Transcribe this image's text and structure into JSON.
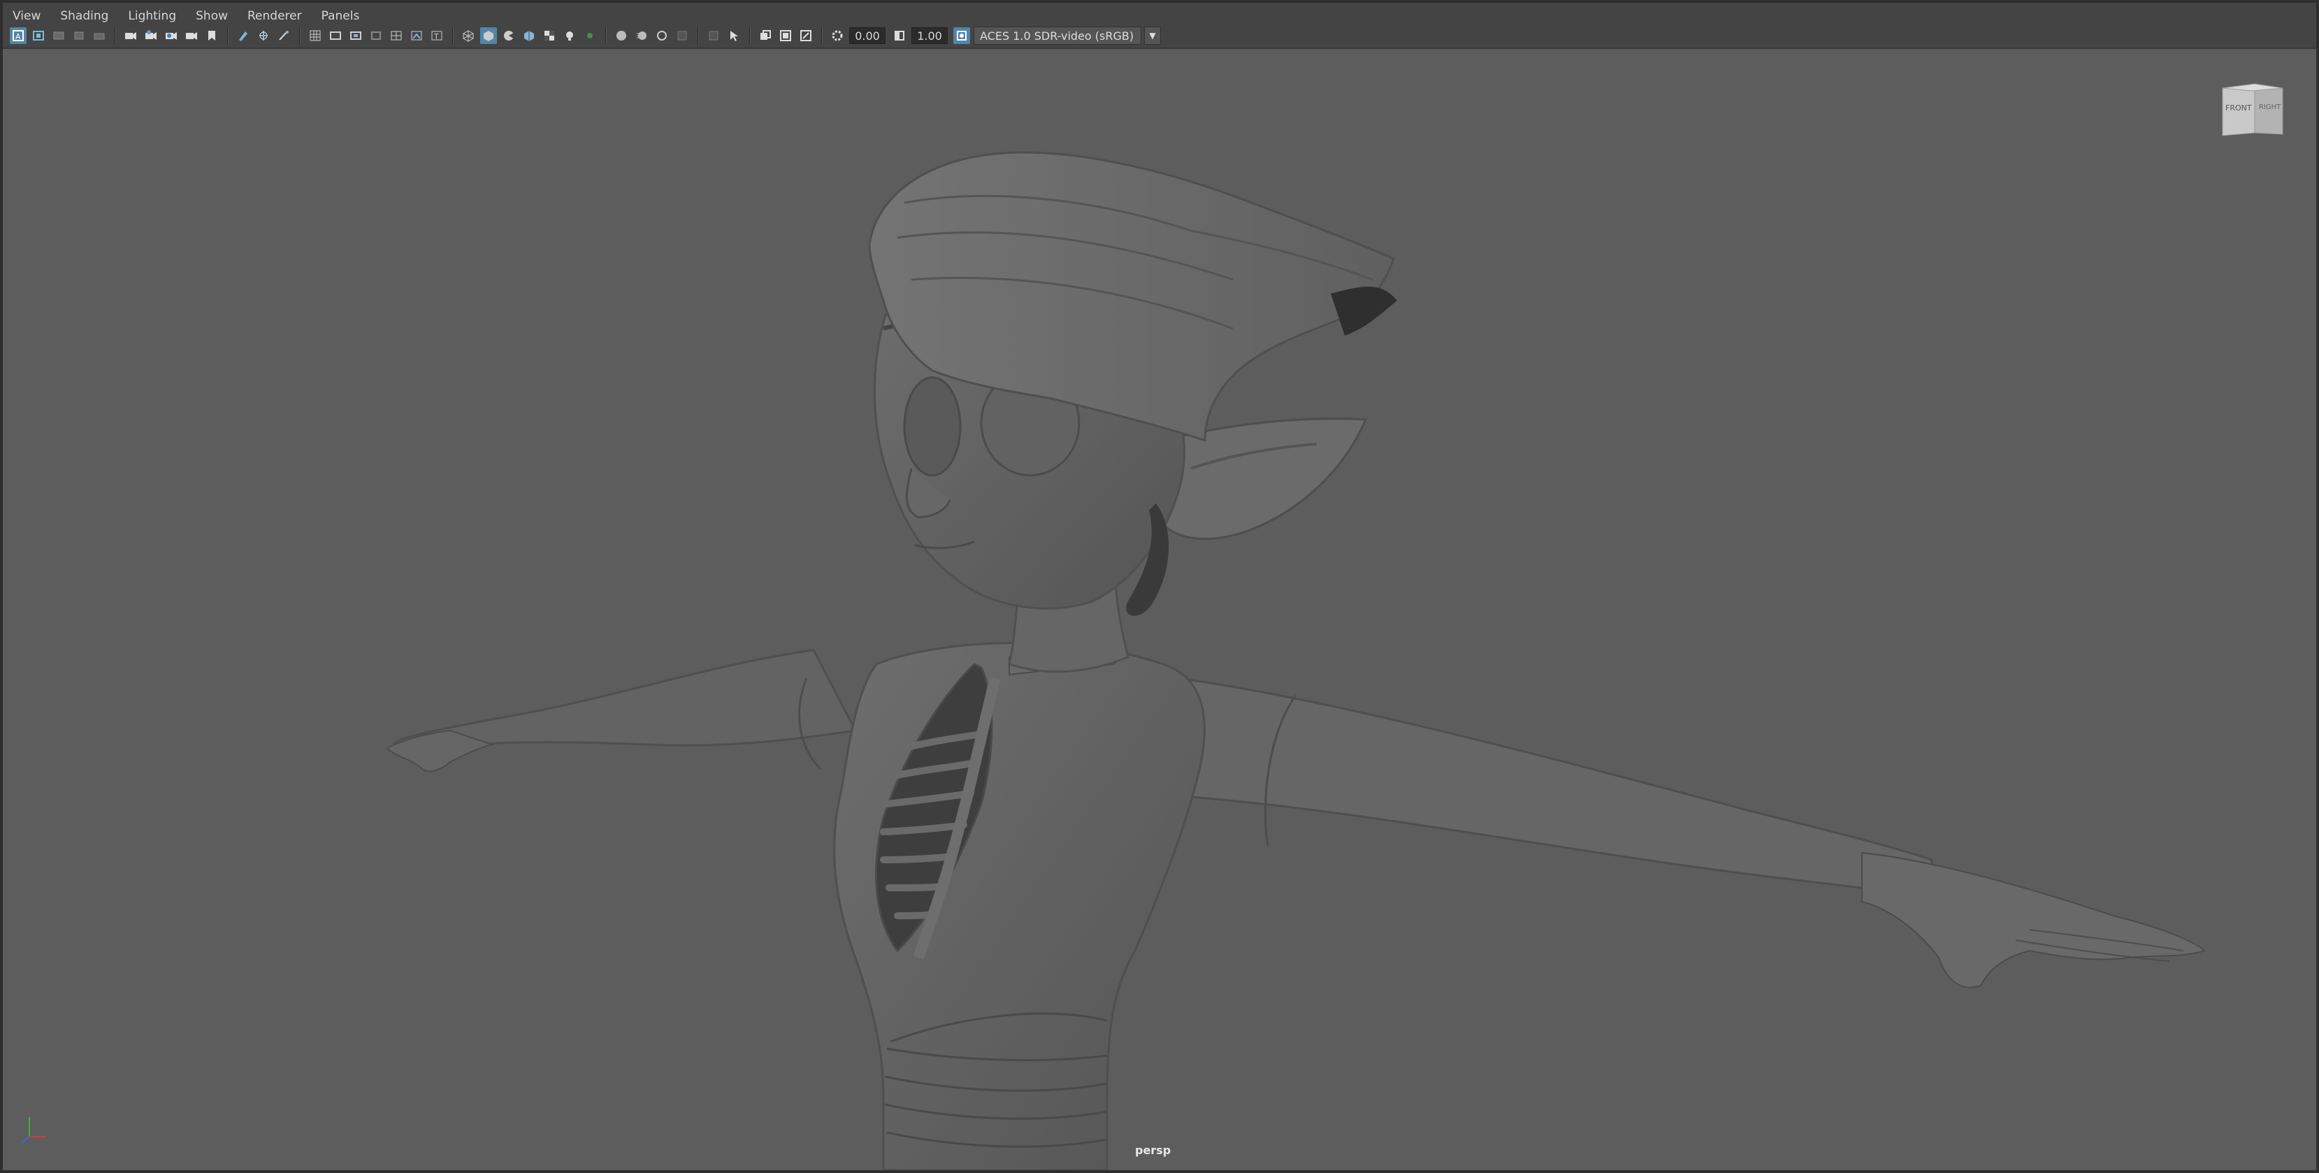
{
  "menu": {
    "items": [
      "View",
      "Shading",
      "Lighting",
      "Show",
      "Renderer",
      "Panels"
    ]
  },
  "toolbar": {
    "exposure_value": "0.00",
    "gamma_value": "1.00",
    "color_space": "ACES 1.0 SDR-video (sRGB)",
    "icons": [
      "select-camera-icon",
      "camera-attributes-icon",
      "bookmarks-icon",
      "image-plane-icon",
      "view-2d-pan-icon",
      "camera-icon",
      "lock-camera-icon",
      "snapshot-icon",
      "playblast-icon",
      "bookmark-icon",
      "grease-pencil-icon",
      "film-gate-icon",
      "resolution-gate-icon",
      "gate-mask-icon",
      "field-chart-icon",
      "safe-action-icon",
      "safe-title-icon",
      "grid-icon",
      "wireframe-icon",
      "smooth-shade-icon",
      "default-material-icon",
      "textured-icon",
      "use-all-lights-icon",
      "shadows-icon",
      "ambient-occlusion-icon",
      "motion-blur-icon",
      "anti-aliasing-icon",
      "depth-of-field-icon",
      "isolate-select-icon",
      "xray-icon",
      "xray-joints-icon",
      "backface-culling-icon",
      "exposure-icon",
      "gamma-icon",
      "color-management-icon"
    ]
  },
  "colors": {
    "viewport_bg": "#5d5d5d",
    "accent": "#5285a6",
    "toolbar_bg": "#444444"
  },
  "viewcube": {
    "front_label": "FRONT",
    "right_label": "RIGHT"
  },
  "viewport": {
    "camera_label": "persp"
  }
}
